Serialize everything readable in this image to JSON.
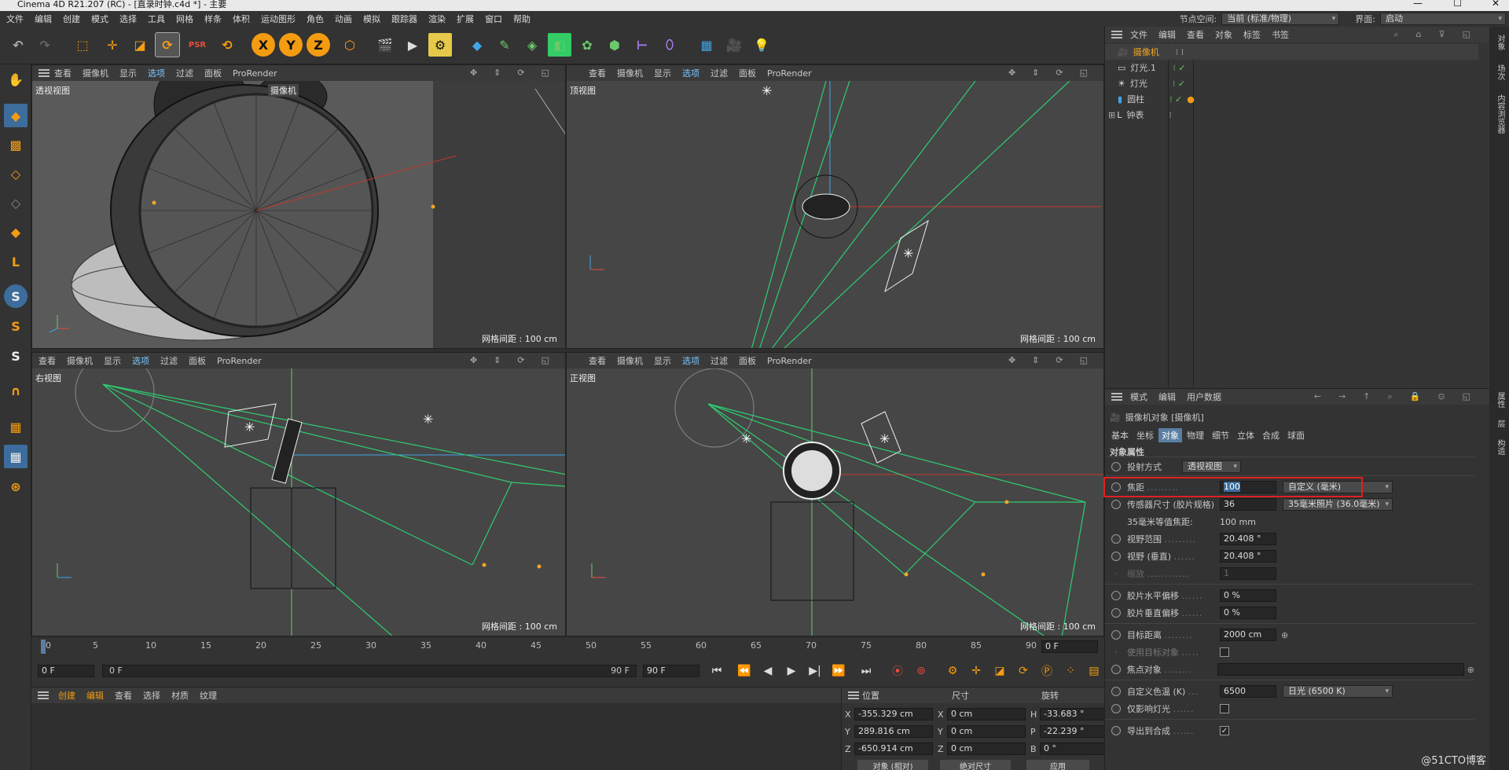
{
  "window": {
    "title": "Cinema 4D R21.207 (RC) - [直录时钟.c4d *] - 主要"
  },
  "menu": {
    "items": [
      "文件",
      "编辑",
      "创建",
      "模式",
      "选择",
      "工具",
      "网格",
      "样条",
      "体积",
      "运动图形",
      "角色",
      "动画",
      "模拟",
      "跟踪器",
      "渲染",
      "扩展",
      "窗口",
      "帮助"
    ],
    "node_space_label": "节点空间:",
    "node_space_value": "当前 (标准/物理)",
    "layout_label": "界面:",
    "layout_value": "启动"
  },
  "viewport_menu": [
    "查看",
    "摄像机",
    "显示",
    "选项",
    "过滤",
    "面板",
    "ProRender"
  ],
  "viewports": [
    {
      "name": "透视视图",
      "grid": "网格间距 : 100 cm",
      "camera_tag": "摄像机"
    },
    {
      "name": "顶视图",
      "grid": "网格间距 : 100 cm"
    },
    {
      "name": "右视图",
      "grid": "网格间距 : 100 cm"
    },
    {
      "name": "正视图",
      "grid": "网格间距 : 100 cm"
    }
  ],
  "object_manager": {
    "menu": [
      "文件",
      "编辑",
      "查看",
      "对象",
      "标签",
      "书签"
    ],
    "objects": [
      {
        "name": "摄像机",
        "color": "#f5a623",
        "active": true
      },
      {
        "name": "灯光.1",
        "color": "#cccccc"
      },
      {
        "name": "灯光",
        "color": "#cccccc"
      },
      {
        "name": "圆柱",
        "color": "#cccccc"
      },
      {
        "name": "钟表",
        "color": "#cccccc"
      }
    ]
  },
  "side_tabs_top": [
    "对象",
    "场次",
    "内容浏览器"
  ],
  "side_tabs_bottom": [
    "属性",
    "层",
    "构造"
  ],
  "attributes": {
    "menu": [
      "模式",
      "编辑",
      "用户数据"
    ],
    "object_title": "摄像机对象 [摄像机]",
    "tabs": [
      "基本",
      "坐标",
      "对象",
      "物理",
      "细节",
      "立体",
      "合成",
      "球面"
    ],
    "active_tab": "对象",
    "section": "对象属性",
    "projection_label": "投射方式",
    "projection_value": "透视视图",
    "focal_label": "焦距",
    "focal_value": "100",
    "focal_unit": "自定义 (毫米)",
    "sensor_label": "传感器尺寸 (胶片规格)",
    "sensor_value": "36",
    "sensor_unit": "35毫米照片 (36.0毫米)",
    "equiv_label": "35毫米等值焦距:",
    "equiv_value": "100 mm",
    "fov_label": "视野范围",
    "fov_value": "20.408 °",
    "fov_v_label": "视野 (垂直)",
    "fov_v_value": "20.408 °",
    "zoom_label": "缩放",
    "zoom_value": "1",
    "film_h_label": "胶片水平偏移",
    "film_h_value": "0 %",
    "film_v_label": "胶片垂直偏移",
    "film_v_value": "0 %",
    "target_dist_label": "目标距离",
    "target_dist_value": "2000 cm",
    "use_target_label": "使用目标对象",
    "focus_obj_label": "焦点对象",
    "color_temp_label": "自定义色温 (K)",
    "color_temp_value": "6500",
    "color_temp_preset": "日光 (6500 K)",
    "affect_lights_label": "仅影响灯光",
    "export_label": "导出到合成"
  },
  "timeline": {
    "ticks": [
      "0",
      "5",
      "10",
      "15",
      "20",
      "25",
      "30",
      "35",
      "40",
      "45",
      "50",
      "55",
      "60",
      "65",
      "70",
      "75",
      "80",
      "85",
      "90"
    ],
    "current": "0 F",
    "start": "0 F",
    "range_start": "0 F",
    "range_end": "90 F",
    "end": "90 F"
  },
  "material": {
    "menu": [
      "创建",
      "编辑",
      "查看",
      "选择",
      "材质",
      "纹理"
    ]
  },
  "coords": {
    "headers": [
      "位置",
      "尺寸",
      "旋转"
    ],
    "rows": [
      {
        "a": "X",
        "pos": "-355.329 cm",
        "b": "X",
        "size": "0 cm",
        "c": "H",
        "rot": "-33.683 °"
      },
      {
        "a": "Y",
        "pos": "289.816 cm",
        "b": "Y",
        "size": "0 cm",
        "c": "P",
        "rot": "-22.239 °"
      },
      {
        "a": "Z",
        "pos": "-650.914 cm",
        "b": "Z",
        "size": "0 cm",
        "c": "B",
        "rot": "0 °"
      }
    ],
    "mode1": "对象 (相对)",
    "mode2": "绝对尺寸",
    "apply": "应用"
  },
  "watermark": "@51CTO博客"
}
